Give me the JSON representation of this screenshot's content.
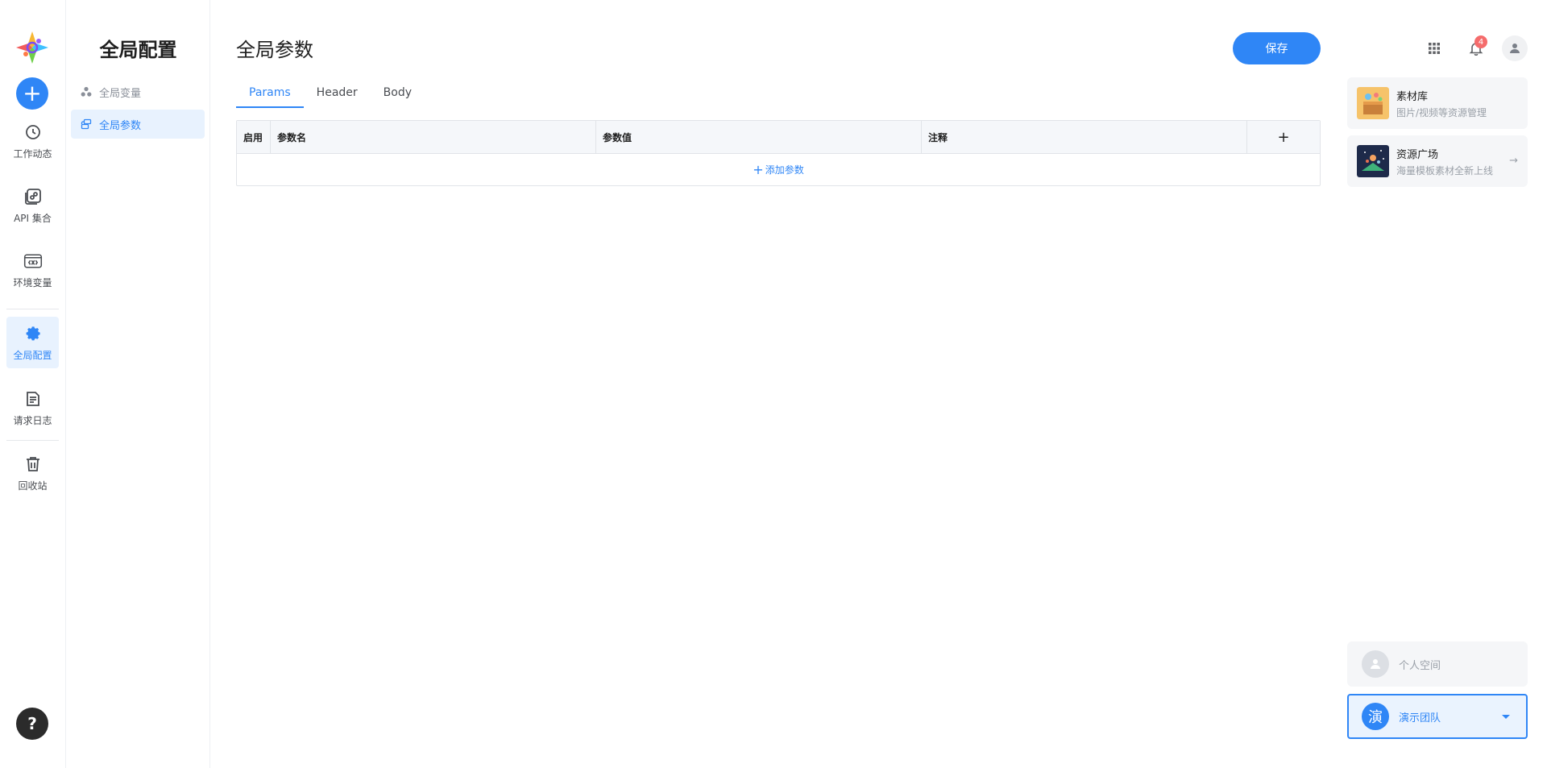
{
  "rail": {
    "items": [
      {
        "label": "工作动态",
        "icon": "clock-icon"
      },
      {
        "label": "API 集合",
        "icon": "api-collection-icon"
      },
      {
        "label": "环境变量",
        "icon": "variable-icon"
      },
      {
        "label": "全局配置",
        "icon": "gear-icon"
      },
      {
        "label": "请求日志",
        "icon": "document-icon"
      },
      {
        "label": "回收站",
        "icon": "trash-icon"
      }
    ],
    "add_label": "+",
    "help_label": "?"
  },
  "subnav": {
    "title": "全局配置",
    "items": [
      {
        "label": "全局变量",
        "icon": "cluster-icon"
      },
      {
        "label": "全局参数",
        "icon": "layers-icon"
      }
    ]
  },
  "main": {
    "title": "全局参数",
    "save_label": "保存",
    "tabs": [
      {
        "label": "Params"
      },
      {
        "label": "Header"
      },
      {
        "label": "Body"
      }
    ],
    "table": {
      "columns": [
        "启用",
        "参数名",
        "参数值",
        "注释",
        "+"
      ],
      "add_row_label": "添加参数"
    }
  },
  "right": {
    "notification_count": "4",
    "cards": [
      {
        "title": "素材库",
        "subtitle": "图片/视频等资源管理"
      },
      {
        "title": "资源广场",
        "subtitle": "海量模板素材全新上线",
        "arrow": "→"
      }
    ],
    "personal_space": "个人空间",
    "team": {
      "avatar_char": "演",
      "name": "演示团队"
    }
  },
  "colors": {
    "accent": "#2f86f6",
    "active_bg": "#e8f2fe",
    "badge": "#f56c6c"
  }
}
